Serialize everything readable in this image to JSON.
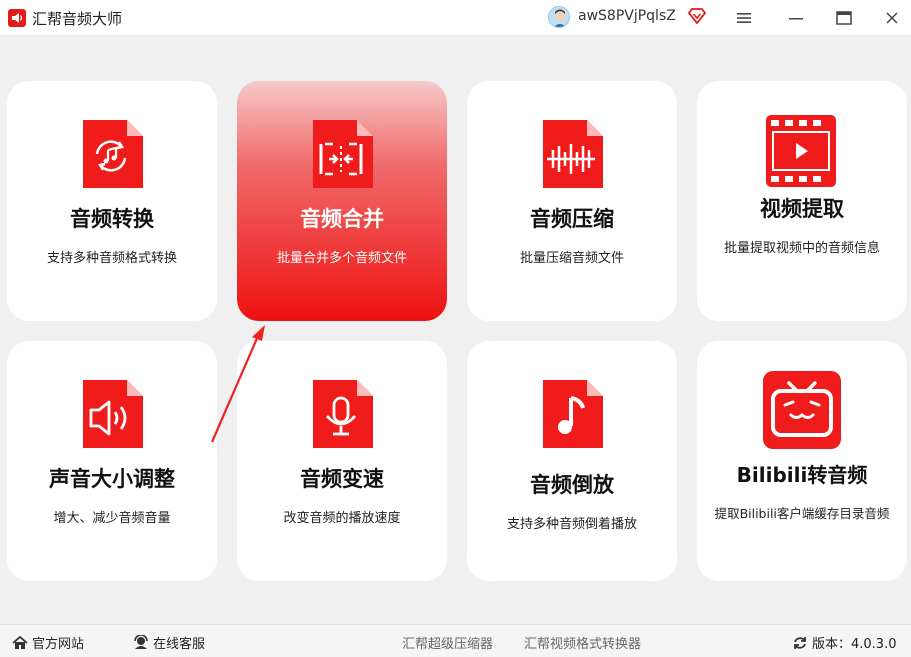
{
  "app": {
    "title": "汇帮音频大师"
  },
  "user": {
    "name": "awS8PVjPqlsZ"
  },
  "cards": [
    {
      "title": "音频转换",
      "desc": "支持多种音频格式转换"
    },
    {
      "title": "音频合并",
      "desc": "批量合并多个音频文件"
    },
    {
      "title": "音频压缩",
      "desc": "批量压缩音频文件"
    },
    {
      "title": "视频提取",
      "desc": "批量提取视频中的音频信息"
    },
    {
      "title": "声音大小调整",
      "desc": "增大、减少音频音量"
    },
    {
      "title": "音频变速",
      "desc": "改变音频的播放速度"
    },
    {
      "title": "音频倒放",
      "desc": "支持多种音频倒着播放"
    },
    {
      "title": "Bilibili转音频",
      "desc": "提取Bilibili客户端缓存目录音频"
    }
  ],
  "footer": {
    "website": "官方网站",
    "service": "在线客服",
    "link1": "汇帮超级压缩器",
    "link2": "汇帮视频格式转换器",
    "version": "版本：4.0.3.0"
  },
  "colors": {
    "accent": "#e31b1b",
    "icon_red": "#f01c1c"
  }
}
